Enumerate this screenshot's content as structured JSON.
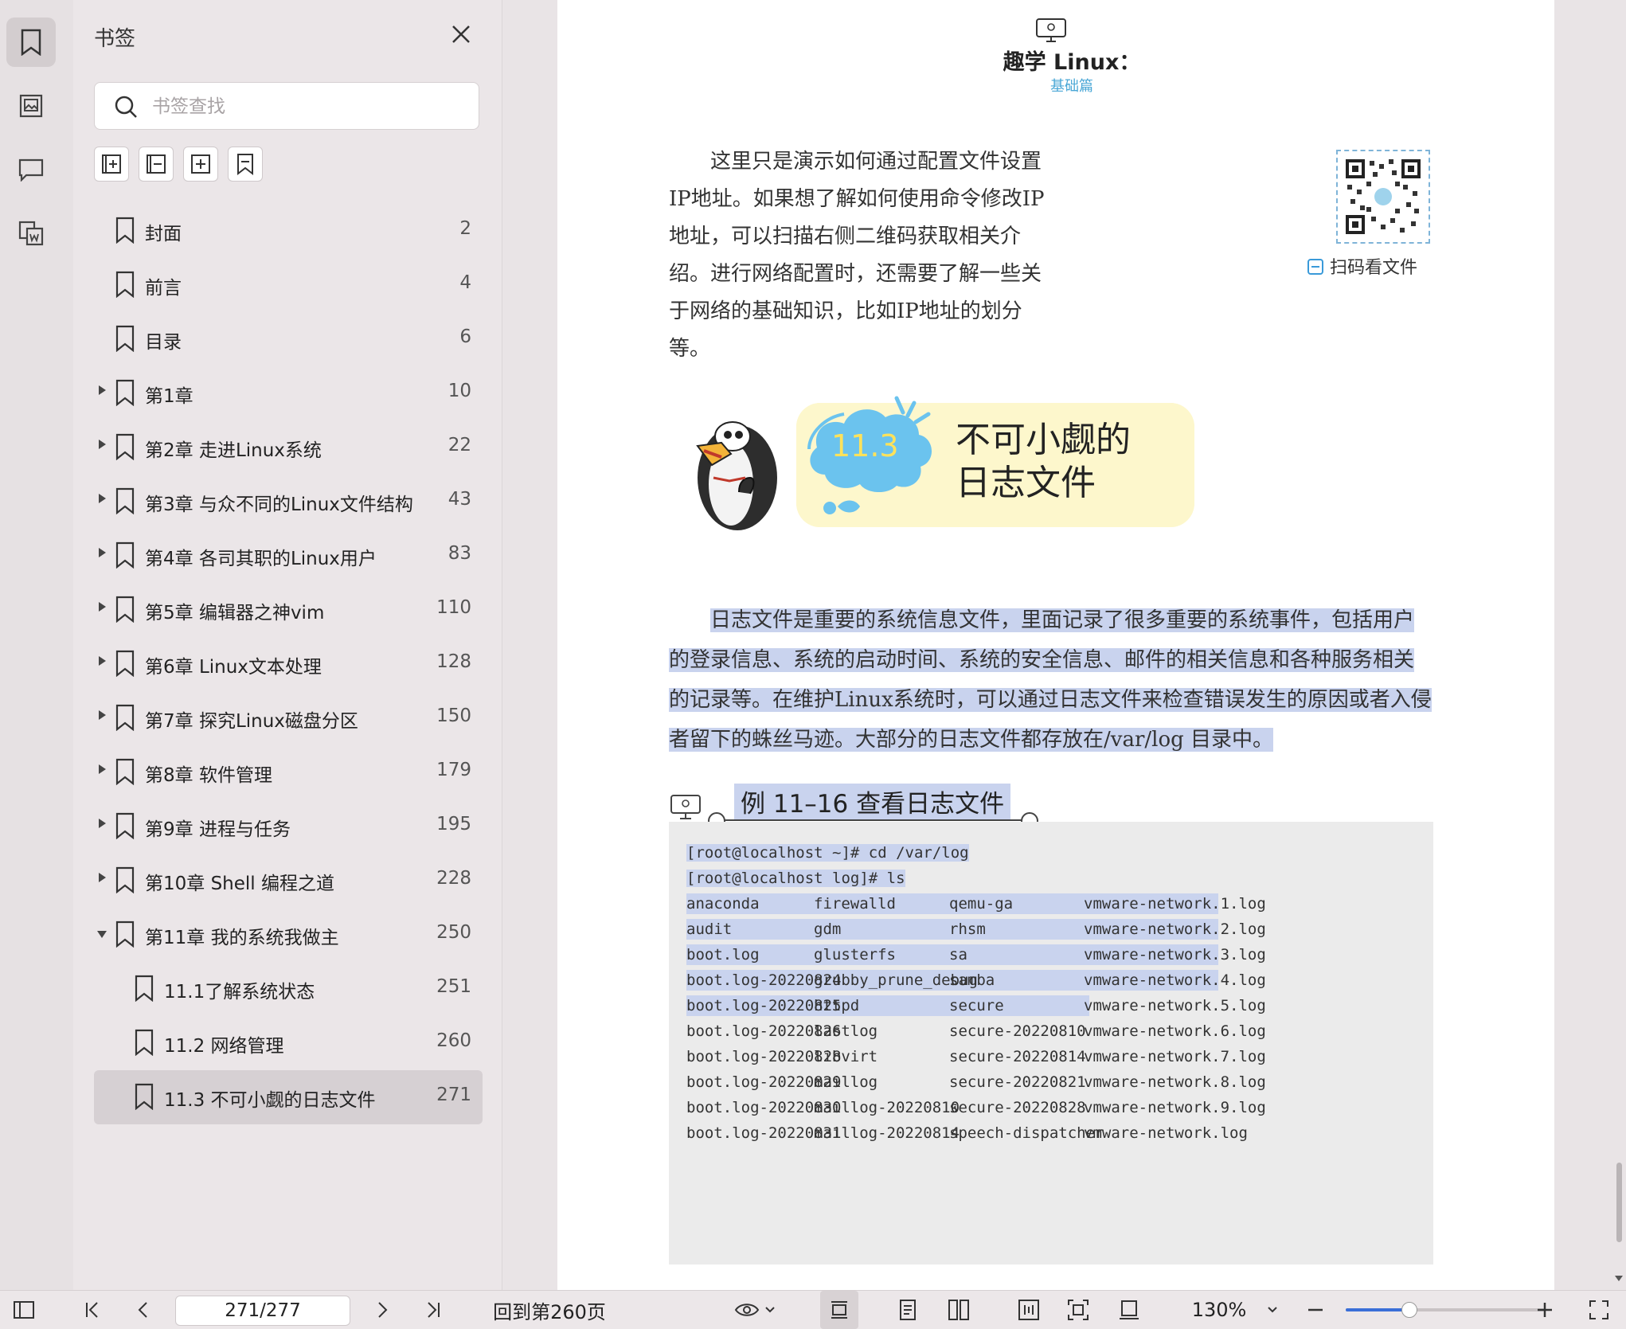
{
  "sidebar": {
    "title": "书签",
    "search_placeholder": "书签查找",
    "items": [
      {
        "label": "封面",
        "page": "2",
        "expand": "none",
        "level": 0
      },
      {
        "label": "前言",
        "page": "4",
        "expand": "none",
        "level": 0
      },
      {
        "label": "目录",
        "page": "6",
        "expand": "none",
        "level": 0
      },
      {
        "label": "第1章",
        "page": "10",
        "expand": "collapsed",
        "level": 0
      },
      {
        "label": "第2章 走进Linux系统",
        "page": "22",
        "expand": "collapsed",
        "level": 0
      },
      {
        "label": "第3章 与众不同的Linux文件结构",
        "page": "43",
        "expand": "collapsed",
        "level": 0
      },
      {
        "label": "第4章 各司其职的Linux用户",
        "page": "83",
        "expand": "collapsed",
        "level": 0
      },
      {
        "label": "第5章 编辑器之神vim",
        "page": "110",
        "expand": "collapsed",
        "level": 0
      },
      {
        "label": "第6章 Linux文本处理",
        "page": "128",
        "expand": "collapsed",
        "level": 0
      },
      {
        "label": "第7章 探究Linux磁盘分区",
        "page": "150",
        "expand": "collapsed",
        "level": 0
      },
      {
        "label": "第8章 软件管理",
        "page": "179",
        "expand": "collapsed",
        "level": 0
      },
      {
        "label": "第9章 进程与任务",
        "page": "195",
        "expand": "collapsed",
        "level": 0
      },
      {
        "label": "第10章 Shell 编程之道",
        "page": "228",
        "expand": "collapsed",
        "level": 0
      },
      {
        "label": "第11章 我的系统我做主",
        "page": "250",
        "expand": "expanded",
        "level": 0
      },
      {
        "label": "11.1了解系统状态",
        "page": "251",
        "expand": "none",
        "level": 1
      },
      {
        "label": "11.2 网络管理",
        "page": "260",
        "expand": "none",
        "level": 1
      },
      {
        "label": "11.3 不可小觑的日志文件",
        "page": "271",
        "expand": "none",
        "level": 1,
        "selected": true
      }
    ]
  },
  "doc": {
    "header_title": "趣学 Linux：",
    "header_sub": "基础篇",
    "para1": "这里只是演示如何通过配置文件设置IP地址。如果想了解如何使用命令修改IP地址，可以扫描右侧二维码获取相关介绍。进行网络配置时，还需要了解一些关于网络的基础知识，比如IP地址的划分等。",
    "qr_caption": "扫码看文件",
    "section_number": "11.3",
    "section_title_1": "不可小觑的",
    "section_title_2": "日志文件",
    "para2": "日志文件是重要的系统信息文件，里面记录了很多重要的系统事件，包括用户的登录信息、系统的启动时间、系统的安全信息、邮件的相关信息和各种服务相关的记录等。在维护Linux系统时，可以通过日志文件来检查错误发生的原因或者入侵者留下的蛛丝马迹。大部分的日志文件都存放在/var/log 目录中。",
    "example_title": "例 11–16   查看日志文件",
    "code_cmds": [
      "[root@localhost ~]# cd /var/log",
      "[root@localhost log]# ls"
    ],
    "code_rows": [
      [
        "anaconda",
        "firewalld",
        "qemu-ga",
        "vmware-network.1.log"
      ],
      [
        "audit",
        "gdm",
        "rhsm",
        "vmware-network.2.log"
      ],
      [
        "boot.log",
        "glusterfs",
        "sa",
        "vmware-network.3.log"
      ],
      [
        "boot.log-20220824",
        "grubby_prune_debug",
        "samba",
        "vmware-network.4.log"
      ],
      [
        "boot.log-20220825",
        "httpd",
        "secure",
        "vmware-network.5.log"
      ],
      [
        "boot.log-20220826",
        "lastlog",
        "secure-20220810",
        "vmware-network.6.log"
      ],
      [
        "boot.log-20220828",
        "libvirt",
        "secure-20220814",
        "vmware-network.7.log"
      ],
      [
        "boot.log-20220829",
        "maillog",
        "secure-20220821",
        "vmware-network.8.log"
      ],
      [
        "boot.log-20220830",
        "maillog-20220810",
        "secure-20220828",
        "vmware-network.9.log"
      ],
      [
        "boot.log-20220831",
        "maillog-20220814",
        "speech-dispatcher",
        "vmware-network.log"
      ]
    ],
    "highlighted_rows": 5
  },
  "toolbar": {
    "page_indicator": "271/277",
    "back_label": "回到第260页",
    "zoom_label": "130%",
    "zoom_fraction": 0.32
  },
  "colors": {
    "accent": "#3a6fd8",
    "highlight": "#c9d3ee",
    "banner": "#fdf7cc",
    "cloud": "#6bc3ee"
  }
}
